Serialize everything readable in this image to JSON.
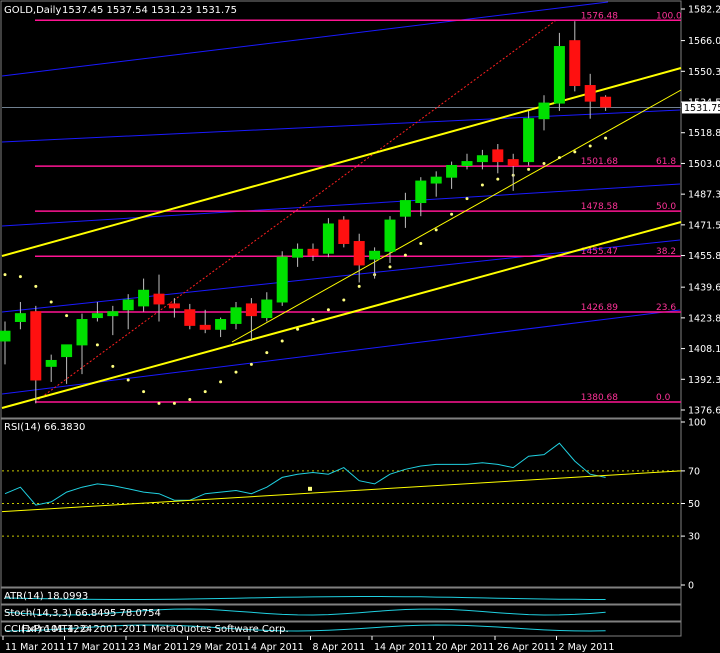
{
  "header": {
    "symbol": "GOLD,Daily",
    "ohlc": "1537.45 1537.54 1531.23 1531.75"
  },
  "footer": {
    "rsi_label": "RSI(14) 66.3830",
    "atr_label": "ATR(14) 18.0993",
    "stoch_label": "Stoch(14,3,3) 66.8495 78.0754",
    "copyright_label": "FxPro MT4, © 2001-2011 MetaQuotes Software Corp.",
    "cci_label": "CCI(14) 101.1224"
  },
  "colors": {
    "background": "#000000",
    "bull": "#00e000",
    "bear": "#ff1010",
    "fib": "#ff1493",
    "channel": "#1a1aff",
    "trend": "#ffff00",
    "rsi": "#20d0e0",
    "sar": "#ffff80"
  },
  "chart_data": {
    "type": "candlestick",
    "ylim": [
      1376.6,
      1582.25
    ],
    "y_ticks": [
      "1582.25",
      "1566.05",
      "1550.30",
      "1534.55",
      "1518.80",
      "1503.05",
      "1487.30",
      "1471.55",
      "1455.80",
      "1439.60",
      "1423.85",
      "1408.10",
      "1392.35",
      "1376.60"
    ],
    "current_price": "1531.75",
    "x_ticks": [
      "11 Mar 2011",
      "17 Mar 2011",
      "23 Mar 2011",
      "29 Mar 2011",
      "4 Apr 2011",
      "8 Apr 2011",
      "14 Apr 2011",
      "20 Apr 2011",
      "26 Apr 2011",
      "2 May 2011"
    ],
    "fib_levels": [
      {
        "price": 1576.48,
        "label": "1576.48",
        "ratio": "100.0"
      },
      {
        "price": 1501.68,
        "label": "1501.68",
        "ratio": "61.8"
      },
      {
        "price": 1478.58,
        "label": "1478.58",
        "ratio": "50.0"
      },
      {
        "price": 1455.47,
        "label": "1455.47",
        "ratio": "38.2"
      },
      {
        "price": 1426.89,
        "label": "1426.89",
        "ratio": "23.6"
      },
      {
        "price": 1380.68,
        "label": "1380.68",
        "ratio": "0.0"
      }
    ],
    "candles": [
      {
        "o": 1412,
        "h": 1422,
        "l": 1400,
        "c": 1417
      },
      {
        "o": 1422,
        "h": 1432,
        "l": 1418,
        "c": 1426
      },
      {
        "o": 1427,
        "h": 1430,
        "l": 1380,
        "c": 1392
      },
      {
        "o": 1399,
        "h": 1405,
        "l": 1391,
        "c": 1402
      },
      {
        "o": 1404,
        "h": 1410,
        "l": 1390,
        "c": 1410
      },
      {
        "o": 1410,
        "h": 1426,
        "l": 1395,
        "c": 1423
      },
      {
        "o": 1424,
        "h": 1432,
        "l": 1422,
        "c": 1426
      },
      {
        "o": 1425,
        "h": 1430,
        "l": 1415,
        "c": 1427
      },
      {
        "o": 1428,
        "h": 1436,
        "l": 1418,
        "c": 1433
      },
      {
        "o": 1430,
        "h": 1444,
        "l": 1427,
        "c": 1438
      },
      {
        "o": 1436,
        "h": 1446,
        "l": 1422,
        "c": 1431
      },
      {
        "o": 1431,
        "h": 1434,
        "l": 1424,
        "c": 1429
      },
      {
        "o": 1428,
        "h": 1431,
        "l": 1418,
        "c": 1420
      },
      {
        "o": 1420,
        "h": 1428,
        "l": 1416,
        "c": 1418
      },
      {
        "o": 1418,
        "h": 1424,
        "l": 1414,
        "c": 1423
      },
      {
        "o": 1421,
        "h": 1432,
        "l": 1418,
        "c": 1429
      },
      {
        "o": 1431,
        "h": 1434,
        "l": 1412,
        "c": 1425
      },
      {
        "o": 1424,
        "h": 1437,
        "l": 1422,
        "c": 1433
      },
      {
        "o": 1432,
        "h": 1458,
        "l": 1430,
        "c": 1455
      },
      {
        "o": 1455,
        "h": 1462,
        "l": 1450,
        "c": 1459
      },
      {
        "o": 1459,
        "h": 1462,
        "l": 1453,
        "c": 1456
      },
      {
        "o": 1457,
        "h": 1475,
        "l": 1455,
        "c": 1472
      },
      {
        "o": 1474,
        "h": 1476,
        "l": 1460,
        "c": 1462
      },
      {
        "o": 1463,
        "h": 1467,
        "l": 1442,
        "c": 1451
      },
      {
        "o": 1454,
        "h": 1460,
        "l": 1444,
        "c": 1458
      },
      {
        "o": 1458,
        "h": 1476,
        "l": 1452,
        "c": 1474
      },
      {
        "o": 1476,
        "h": 1488,
        "l": 1470,
        "c": 1484
      },
      {
        "o": 1483,
        "h": 1496,
        "l": 1476,
        "c": 1494
      },
      {
        "o": 1493,
        "h": 1499,
        "l": 1486,
        "c": 1496
      },
      {
        "o": 1496,
        "h": 1504,
        "l": 1490,
        "c": 1502
      },
      {
        "o": 1502,
        "h": 1508,
        "l": 1500,
        "c": 1504
      },
      {
        "o": 1504,
        "h": 1510,
        "l": 1500,
        "c": 1507
      },
      {
        "o": 1510,
        "h": 1513,
        "l": 1498,
        "c": 1504
      },
      {
        "o": 1505,
        "h": 1508,
        "l": 1489,
        "c": 1502
      },
      {
        "o": 1504,
        "h": 1530,
        "l": 1502,
        "c": 1526
      },
      {
        "o": 1526,
        "h": 1538,
        "l": 1520,
        "c": 1534
      },
      {
        "o": 1534,
        "h": 1570,
        "l": 1530,
        "c": 1563
      },
      {
        "o": 1566,
        "h": 1576,
        "l": 1540,
        "c": 1543
      },
      {
        "o": 1543,
        "h": 1549,
        "l": 1526,
        "c": 1535
      },
      {
        "o": 1537,
        "h": 1538,
        "l": 1530,
        "c": 1532
      }
    ],
    "rsi": {
      "ylim": [
        0,
        100
      ],
      "levels": [
        70,
        50,
        30
      ],
      "tick_labels": [
        "100",
        "70",
        "50",
        "30",
        "0"
      ],
      "values": [
        56,
        60,
        49,
        51,
        57,
        60,
        62,
        61,
        59,
        57,
        56,
        52,
        52,
        56,
        57,
        58,
        56,
        60,
        66,
        68,
        69,
        68,
        72,
        64,
        62,
        68,
        71,
        73,
        74,
        74,
        74,
        75,
        74,
        72,
        79,
        80,
        87,
        76,
        68,
        66
      ]
    },
    "parabolic_sar": [
      1446,
      1445,
      1440,
      1432,
      1425,
      1420,
      1410,
      1399,
      1392,
      1386,
      1380,
      1380,
      1382,
      1386,
      1391,
      1396,
      1400,
      1406,
      1412,
      1418,
      1423,
      1428,
      1433,
      1440,
      1446,
      1450,
      1456,
      1462,
      1469,
      1477,
      1485,
      1492,
      1495,
      1497,
      1500,
      1503,
      1506,
      1509,
      1512,
      1516
    ]
  }
}
